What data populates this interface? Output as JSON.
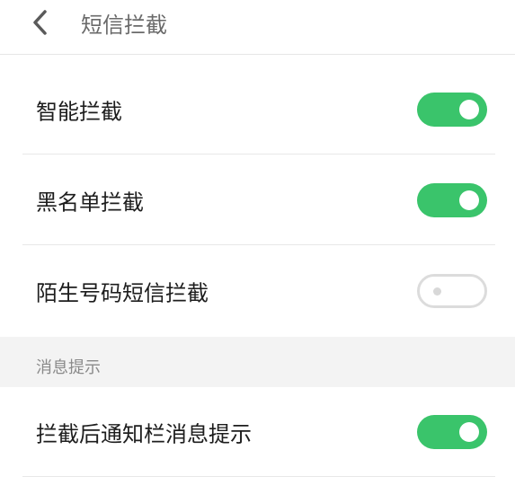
{
  "header": {
    "title": "短信拦截",
    "back_icon": "chevron-left-icon"
  },
  "settings": [
    {
      "label": "智能拦截",
      "enabled": true
    },
    {
      "label": "黑名单拦截",
      "enabled": true
    },
    {
      "label": "陌生号码短信拦截",
      "enabled": false
    }
  ],
  "section": {
    "title": "消息提示"
  },
  "notification_settings": [
    {
      "label": "拦截后通知栏消息提示",
      "enabled": true
    }
  ],
  "colors": {
    "toggle_on": "#3ac46b",
    "toggle_off_border": "#dcdcdc",
    "section_bg": "#f3f3f3"
  }
}
